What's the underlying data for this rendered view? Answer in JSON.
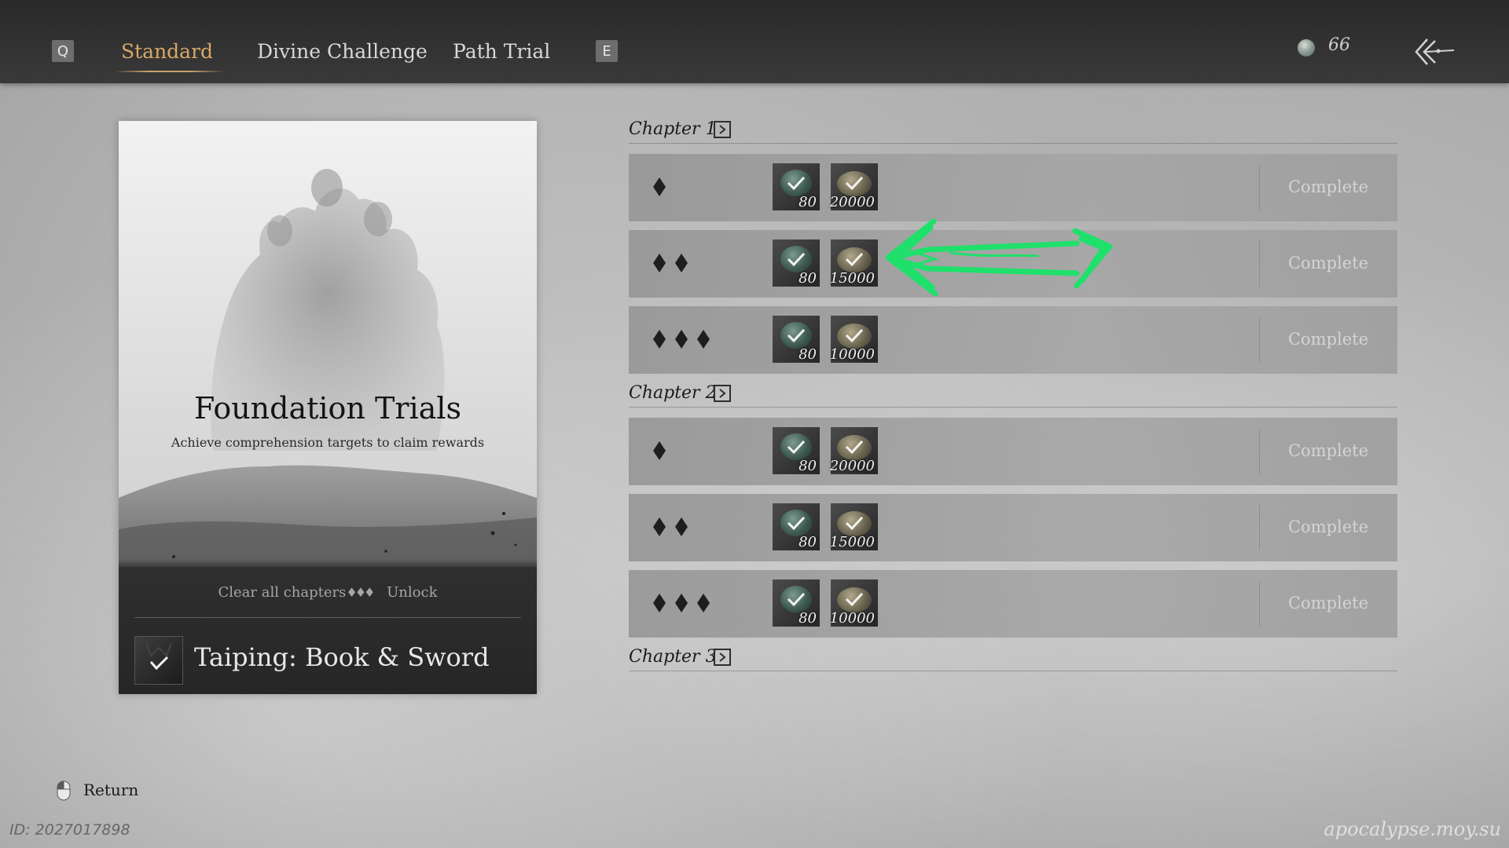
{
  "topbar": {
    "key_left": "Q",
    "key_right": "E",
    "tabs": [
      {
        "label": "Standard",
        "active": true
      },
      {
        "label": "Divine Challenge",
        "active": false
      },
      {
        "label": "Path Trial",
        "active": false
      }
    ],
    "currency": {
      "icon": "jade-coin-icon",
      "amount": "66"
    },
    "back_icon": "back-arrow-icon"
  },
  "card": {
    "title": "Foundation Trials",
    "subtitle": "Achieve comprehension targets to claim rewards",
    "unlock_condition": "Clear all chapters",
    "unlock_condition_diamonds": "♦♦♦",
    "unlock_label": "Unlock",
    "reward_name": "Taiping: Book & Sword",
    "reward_claimed": true
  },
  "chapters": [
    {
      "label": "Chapter 1",
      "rows": [
        {
          "diamonds": 1,
          "rewards": [
            "80",
            "20000"
          ],
          "status": "Complete"
        },
        {
          "diamonds": 2,
          "rewards": [
            "80",
            "15000"
          ],
          "status": "Complete"
        },
        {
          "diamonds": 3,
          "rewards": [
            "80",
            "10000"
          ],
          "status": "Complete"
        }
      ]
    },
    {
      "label": "Chapter 2",
      "rows": [
        {
          "diamonds": 1,
          "rewards": [
            "80",
            "20000"
          ],
          "status": "Complete"
        },
        {
          "diamonds": 2,
          "rewards": [
            "80",
            "15000"
          ],
          "status": "Complete"
        },
        {
          "diamonds": 3,
          "rewards": [
            "80",
            "10000"
          ],
          "status": "Complete"
        }
      ]
    },
    {
      "label": "Chapter 3",
      "rows": []
    }
  ],
  "footer": {
    "return_label": "Return",
    "id_text": "ID: 2027017898",
    "watermark": "apocalypse.moy.su"
  },
  "colors": {
    "active_tab": "#d7a868",
    "annotation_arrow": "#1fe06a"
  }
}
